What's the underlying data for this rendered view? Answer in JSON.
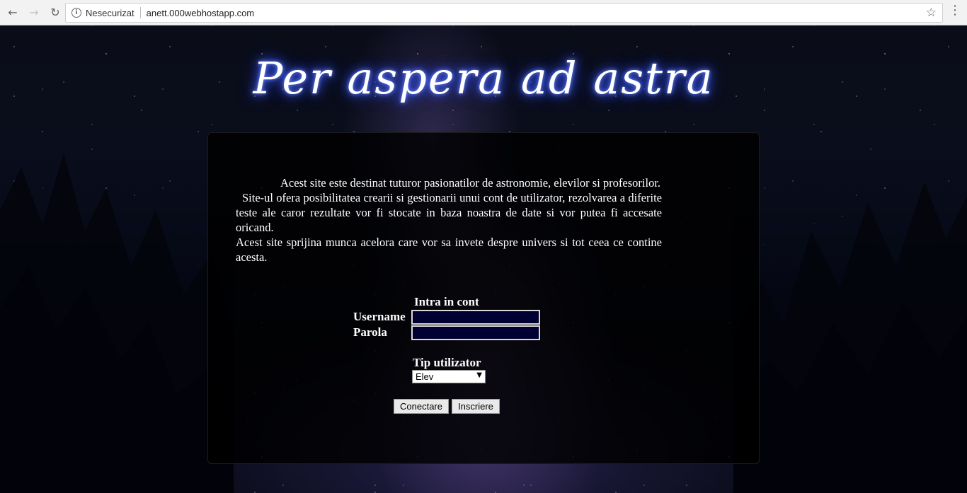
{
  "browser": {
    "security_label": "Nesecurizat",
    "url": "anett.000webhostapp.com",
    "icons": {
      "back": "back-arrow-icon",
      "forward": "forward-arrow-icon",
      "reload": "reload-icon",
      "info": "info-icon",
      "bookmark": "star-icon",
      "menu": "kebab-menu-icon"
    }
  },
  "page": {
    "title": "Per aspera ad astra",
    "intro": {
      "paragraph1": "Acest site este destinat tuturor pasionatilor de astronomie, elevilor si profesorilor.",
      "paragraph2": "Site-ul ofera posibilitatea crearii si gestionarii unui cont de utilizator, rezolvarea a diferite teste ale caror rezultate vor fi stocate in baza noastra de date si vor putea fi accesate oricand.",
      "paragraph3": "Acest site sprijina munca acelora care vor sa invete despre univers si tot ceea ce contine acesta."
    },
    "login": {
      "heading": "Intra in cont",
      "username_label": "Username",
      "username_value": "",
      "password_label": "Parola",
      "password_value": "",
      "user_type_label": "Tip utilizator",
      "user_type_selected": "Elev",
      "connect_button": "Conectare",
      "register_button": "Inscriere"
    }
  },
  "colors": {
    "title_glow": "#3d5cff",
    "input_background": "#000033",
    "panel_background": "#000000"
  }
}
